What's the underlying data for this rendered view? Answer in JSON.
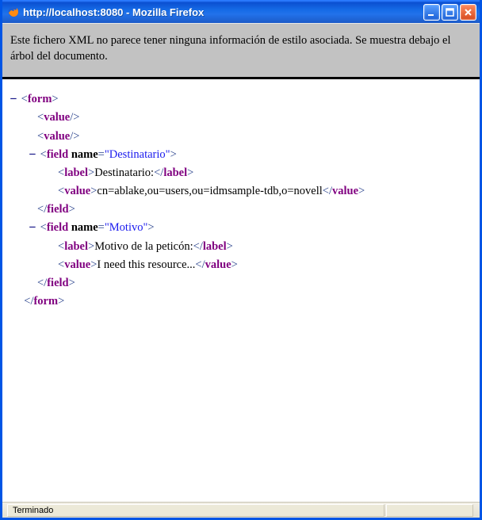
{
  "window": {
    "title": "http://localhost:8080 - Mozilla Firefox"
  },
  "info": {
    "message": "Este fichero XML no parece tener ninguna información de estilo asociada. Se muestra debajo el árbol del documento."
  },
  "xml": {
    "root_tag": "form",
    "self1_tag": "value",
    "self2_tag": "value",
    "field1": {
      "tag": "field",
      "attr_name": "name",
      "attr_value": "\"Destinatario\"",
      "label_tag": "label",
      "label_text": "Destinatario:",
      "value_tag": "value",
      "value_text": "cn=ablake,ou=users,ou=idmsample-tdb,o=novell"
    },
    "field2": {
      "tag": "field",
      "attr_name": "name",
      "attr_value": "\"Motivo\"",
      "label_tag": "label",
      "label_text": "Motivo de la peticón:",
      "value_tag": "value",
      "value_text": "I need this resource..."
    }
  },
  "status": {
    "text": "Terminado"
  },
  "glyphs": {
    "minus": "−",
    "lt": "<",
    "gt": ">",
    "slash": "/",
    "eq": "="
  }
}
